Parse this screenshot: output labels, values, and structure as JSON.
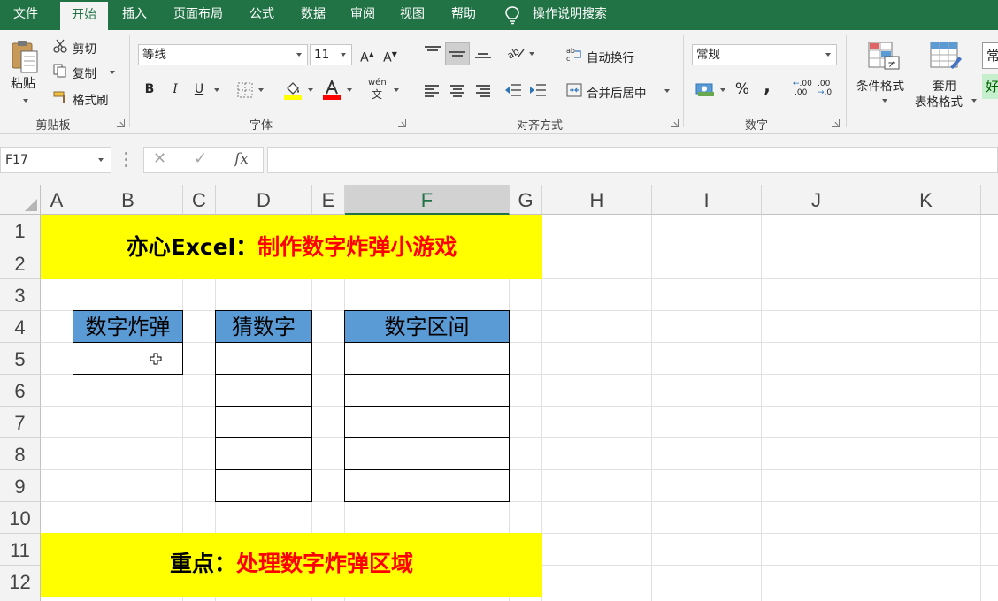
{
  "tabs": [
    "文件",
    "开始",
    "插入",
    "页面布局",
    "公式",
    "数据",
    "审阅",
    "视图",
    "帮助"
  ],
  "active_tab": "开始",
  "tell_me": "操作说明搜索",
  "clipboard": {
    "paste": "粘贴",
    "cut": "剪切",
    "copy": "复制",
    "format_painter": "格式刷",
    "label": "剪贴板"
  },
  "font": {
    "name": "等线",
    "size": "11",
    "label": "字体",
    "bold": "B",
    "italic": "I",
    "underline": "U",
    "grow": "A",
    "shrink": "A",
    "phonetic": "wén"
  },
  "alignment": {
    "wrap": "自动换行",
    "merge": "合并后居中",
    "label": "对齐方式"
  },
  "number": {
    "format": "常规",
    "percent": "%",
    "comma": ",",
    "inc_decimal": ".00",
    "dec_decimal": ".00",
    "label": "数字"
  },
  "styles": {
    "conditional": "条件格式",
    "table_l1": "套用",
    "table_l2": "表格格式",
    "style_normal": "常",
    "style_good": "好"
  },
  "colors": {
    "brand": "#217346",
    "banner": "#ffff00",
    "header_cell": "#5b9bd5",
    "red_text": "#ff0000",
    "fill_swatch": "#ffff00",
    "font_swatch": "#ff0000"
  },
  "formula_bar": {
    "name_box": "F17",
    "cancel": "✕",
    "enter": "✓",
    "fx": "fx",
    "value": ""
  },
  "grid": {
    "columns": [
      "A",
      "B",
      "C",
      "D",
      "E",
      "F",
      "G",
      "H",
      "I",
      "J",
      "K"
    ],
    "selected_column": "F",
    "rows": [
      "1",
      "2",
      "3",
      "4",
      "5",
      "6",
      "7",
      "8",
      "9",
      "10",
      "11",
      "12"
    ]
  },
  "sheet": {
    "title_black": "亦心Excel：",
    "title_red": "制作数字炸弹小游戏",
    "header_bomb": "数字炸弹",
    "header_guess": "猜数字",
    "header_range": "数字区间",
    "note_black": "重点：",
    "note_red": "处理数字炸弹区域"
  }
}
